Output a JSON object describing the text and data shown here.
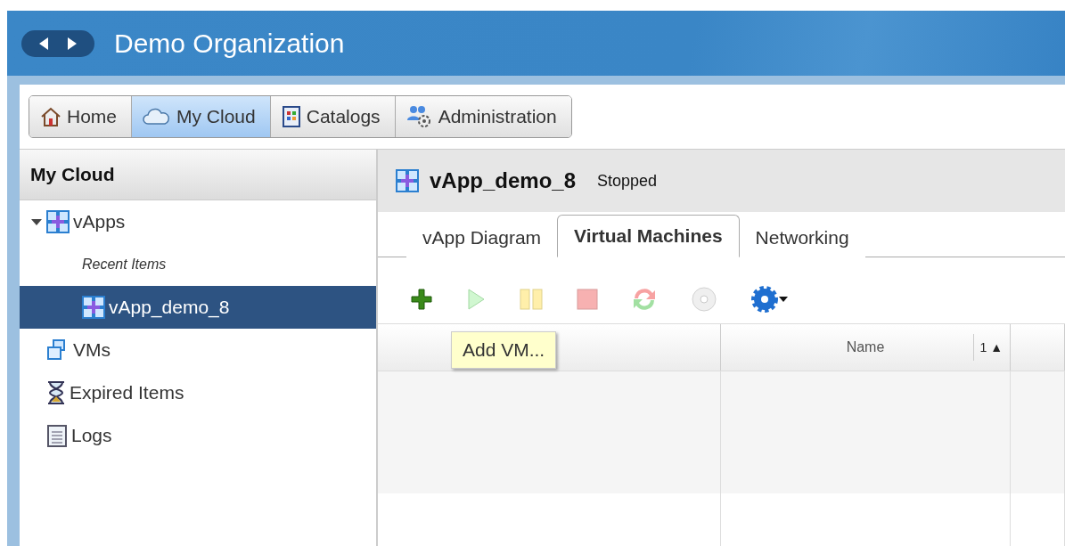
{
  "header": {
    "title": "Demo Organization"
  },
  "nav_tabs": [
    {
      "label": "Home",
      "kind": "home",
      "selected": false
    },
    {
      "label": "My Cloud",
      "kind": "cloud",
      "selected": true
    },
    {
      "label": "Catalogs",
      "kind": "catalog",
      "selected": false
    },
    {
      "label": "Administration",
      "kind": "admin",
      "selected": false
    }
  ],
  "sidebar": {
    "title": "My Cloud",
    "items": [
      {
        "label": "vApps",
        "kind": "vapp",
        "expanded": true,
        "children": [
          {
            "label": "Recent Items",
            "kind": "heading"
          },
          {
            "label": "vApp_demo_8",
            "kind": "vapp",
            "selected": true
          }
        ]
      },
      {
        "label": "VMs",
        "kind": "vms"
      },
      {
        "label": "Expired Items",
        "kind": "hourglass"
      },
      {
        "label": "Logs",
        "kind": "logs"
      }
    ]
  },
  "detail": {
    "title": "vApp_demo_8",
    "status": "Stopped",
    "tabs": [
      {
        "label": "vApp Diagram",
        "selected": false
      },
      {
        "label": "Virtual Machines",
        "selected": true
      },
      {
        "label": "Networking",
        "selected": false
      }
    ],
    "toolbar": [
      {
        "kind": "add",
        "disabled": false
      },
      {
        "kind": "start",
        "disabled": true
      },
      {
        "kind": "pause",
        "disabled": true
      },
      {
        "kind": "stop",
        "disabled": true
      },
      {
        "kind": "reset",
        "disabled": true
      },
      {
        "kind": "media",
        "disabled": true
      },
      {
        "kind": "gear",
        "disabled": false
      }
    ],
    "tooltip": "Add VM...",
    "table": {
      "columns": [
        {},
        {
          "label": "Name",
          "sort": "1 ▲"
        }
      ]
    }
  }
}
